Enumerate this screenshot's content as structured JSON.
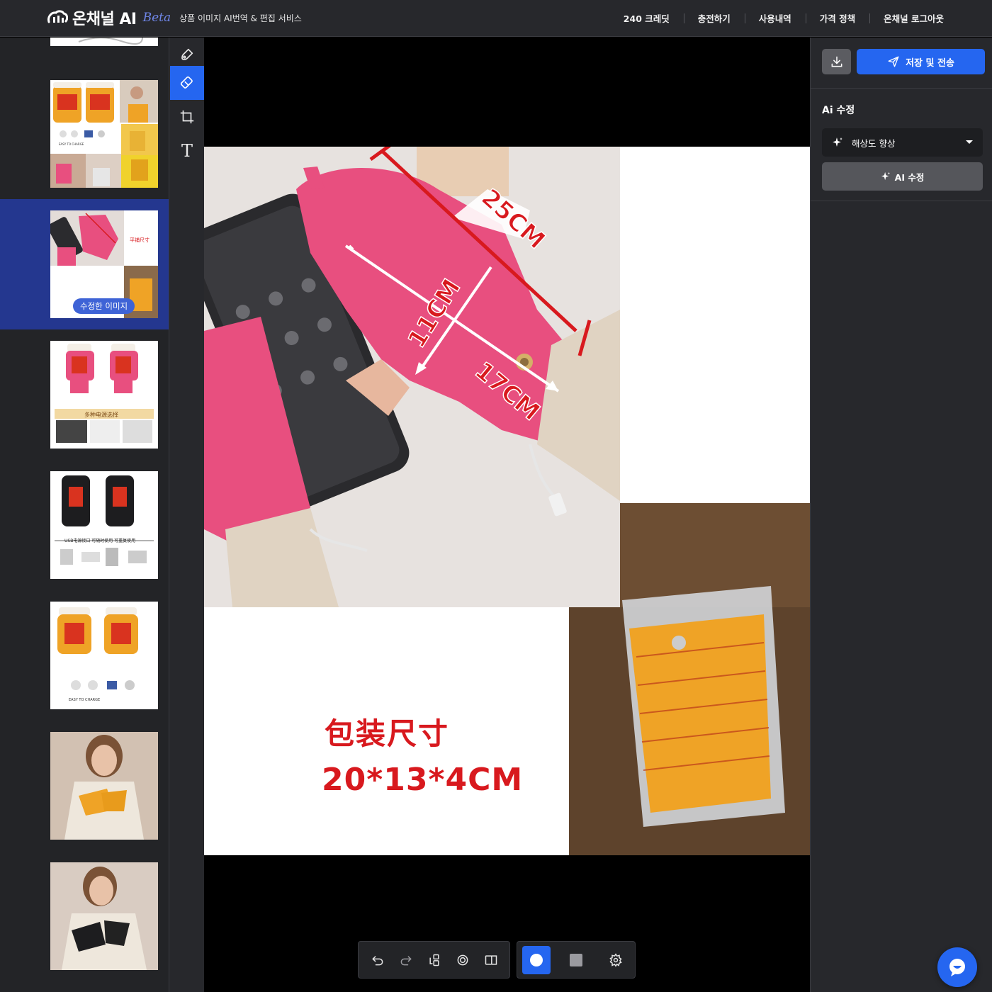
{
  "header": {
    "brand": "온채널 AI",
    "beta": "Beta",
    "tagline": "상품 이미지 AI번역 & 편집 서비스",
    "nav": [
      {
        "label": "240 크레딧"
      },
      {
        "label": "충전하기"
      },
      {
        "label": "사용내역"
      },
      {
        "label": "가격 정책"
      },
      {
        "label": "온채널 로그아웃"
      }
    ]
  },
  "thumbnails": {
    "edited_badge": "수정한 이미지",
    "thumb3_banner": "多种电源选择",
    "thumb4_banner": "USB电源接口 可随时使用 可重复使用",
    "thumb5_caption": "EASY TO CHARGE",
    "thumb1_caption": "EASY TO CHARGE",
    "thumb2_caption": "平铺尺寸"
  },
  "canvas": {
    "package_title": "包装尺寸",
    "package_size": "20*13*4CM",
    "measure_25": "25CM",
    "measure_11": "11CM",
    "measure_17": "17CM"
  },
  "panel": {
    "save_label": "저장 및 전송",
    "section_title": "Ai 수정",
    "select_value": "해상도 향상",
    "ai_button": "AI 수정"
  },
  "colors": {
    "accent": "#2566f0",
    "header_bg": "#27282c",
    "active_thumb_bg": "#24378f",
    "measure_red": "#d8191e",
    "glove_pink": "#e84f7f",
    "glove_orange": "#efa326"
  },
  "icons": [
    "logo-icon",
    "brush-icon",
    "eraser-icon",
    "crop-icon",
    "text-icon",
    "undo-icon",
    "redo-icon",
    "layers-icon",
    "target-icon",
    "compare-icon",
    "circle-icon",
    "square-icon",
    "gear-icon",
    "download-icon",
    "send-icon",
    "sparkle-icon",
    "chevron-down-icon",
    "chat-icon"
  ]
}
